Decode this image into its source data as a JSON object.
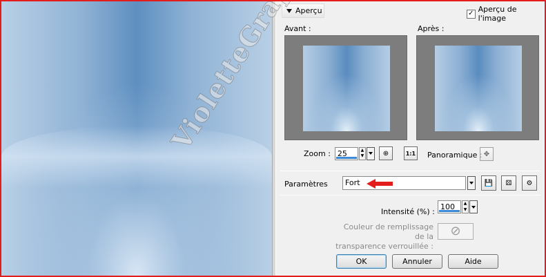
{
  "preview": {
    "section_label": "Aperçu",
    "image_preview_label": "Aperçu de l'image",
    "image_preview_checked": true,
    "before_label": "Avant :",
    "after_label": "Après :",
    "zoom_label": "Zoom :",
    "zoom_value": "25",
    "pan_label": "Panoramique :"
  },
  "presets": {
    "label": "Paramètres",
    "value": "Fort"
  },
  "settings": {
    "intensity_label": "Intensité (%) :",
    "intensity_value": "100",
    "fill_label_line1": "Couleur de remplissage de la",
    "fill_label_line2": "transparence verrouillée :"
  },
  "buttons": {
    "ok": "OK",
    "cancel": "Annuler",
    "help": "Aide"
  },
  "watermark": "VioletteGraphic",
  "colors": {
    "frame": "#e31c1c",
    "arrow": "#e31c1c",
    "accent": "#3b8ad9"
  }
}
